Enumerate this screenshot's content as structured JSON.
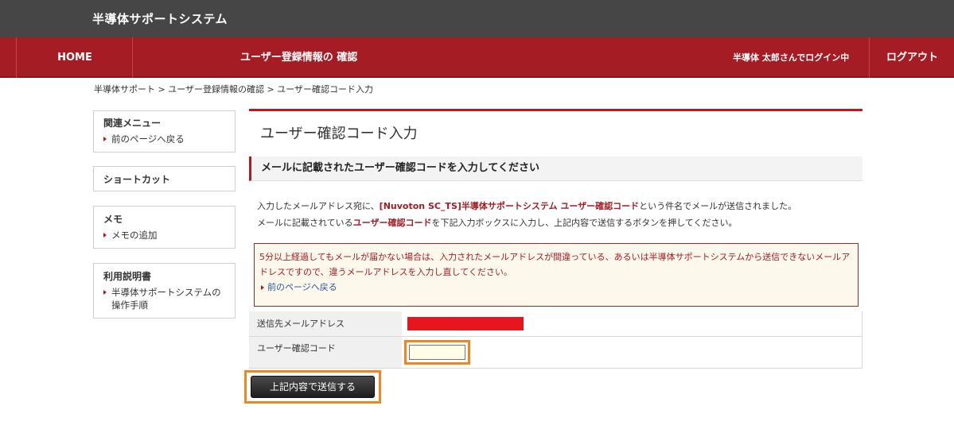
{
  "header": {
    "site_title": "半導体サポートシステム"
  },
  "nav": {
    "home": "HOME",
    "page_title": "ユーザー登録情報の 確認",
    "user_status": "半導体 太郎さんでログイン中",
    "logout": "ログアウト"
  },
  "breadcrumb": {
    "items": [
      "半導体サポート",
      "ユーザー登録情報の確認",
      "ユーザー確認コード入力"
    ],
    "separator": ">"
  },
  "sidebar": {
    "related": {
      "title": "関連メニュー",
      "links": [
        "前のページへ戻る"
      ]
    },
    "shortcut": {
      "title": "ショートカット"
    },
    "memo": {
      "title": "メモ",
      "links": [
        "メモの追加"
      ]
    },
    "manual": {
      "title": "利用説明書",
      "links": [
        "半導体サポートシステムの操作手順"
      ]
    }
  },
  "main": {
    "title": "ユーザー確認コード入力",
    "section_heading": "メールに記載されたユーザー確認コードを入力してください",
    "desc1": {
      "before": "入力したメールアドレス宛に、",
      "emphasis": "[Nuvoton SC_TS]半導体サポートシステム ユーザー確認コード",
      "after": "という件名でメールが送信されました。"
    },
    "desc2": {
      "before": "メールに記載されている",
      "emphasis": "ユーザー確認コード",
      "after": "を下記入力ボックスに入力し、上記内容で送信するボタンを押してください。"
    },
    "warning": {
      "line1": "5分以上経過してもメールが届かない場合は、入力されたメールアドレスが間違っている、あるいは半導体サポートシステムから送信できないメールア",
      "line2": "ドレスですので、違うメールアドレスを入力し直してください。",
      "link": "前のページへ戻る"
    },
    "form": {
      "email_label": "送信先メールアドレス",
      "email_value_redacted": true,
      "code_label": "ユーザー確認コード",
      "code_value": "",
      "submit_label": "上記内容で送信する"
    }
  },
  "colors": {
    "topbar": "#464646",
    "navbar": "#a51c24",
    "accent_red": "#c4141e",
    "highlight_orange": "#f0871e",
    "redaction": "#e8141e"
  }
}
